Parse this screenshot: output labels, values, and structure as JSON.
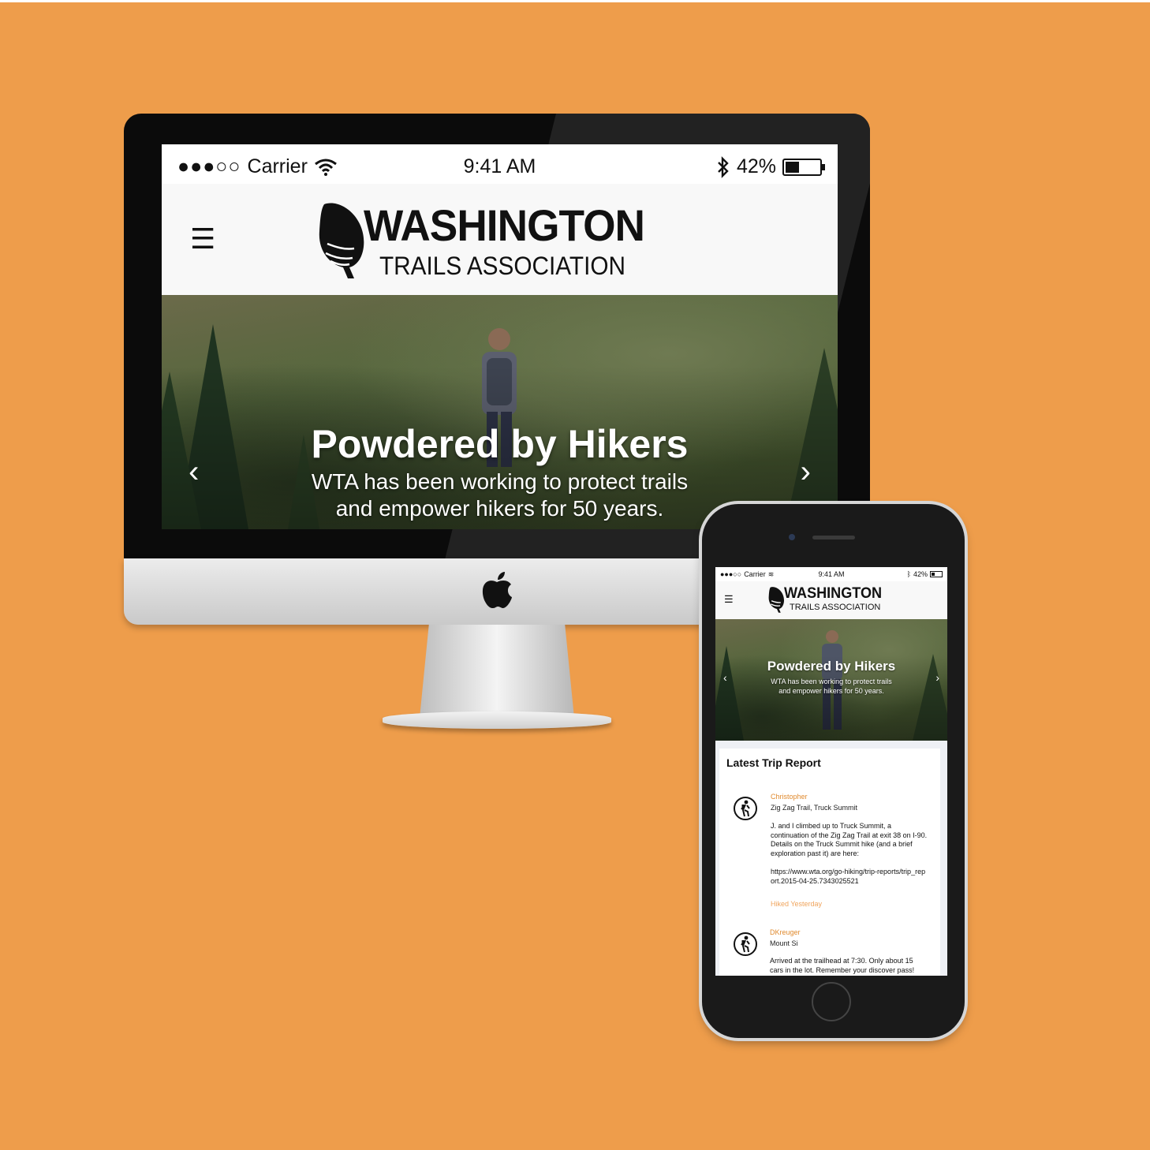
{
  "status_bar": {
    "signal": "●●●○○",
    "carrier": "Carrier",
    "time": "9:41 AM",
    "battery": "42%",
    "battery_level": 0.42
  },
  "logo": {
    "line1": "WASHINGTON",
    "line2": "TRAILS ASSOCIATION"
  },
  "menu_icon": "☰",
  "hero": {
    "title": "Powdered by Hikers",
    "subtitle_line1": "WTA has been working to protect trails",
    "subtitle_line2": "and empower hikers for 50 years.",
    "prev_arrow": "‹",
    "next_arrow": "›"
  },
  "trip_reports": {
    "heading": "Latest Trip Report",
    "items": [
      {
        "author": "Christopher",
        "trail": "Zig Zag Trail, Truck Summit",
        "body": "J. and I climbed up to Truck Summit, a continuation of the Zig Zag Trail at exit 38 on I-90. Details on the Truck Summit hike (and a brief exploration past it) are here:",
        "link": "https://www.wta.org/go-hiking/trip-reports/trip_report.2015-04-25.7343025521",
        "hiked": "Hiked Yesterday"
      },
      {
        "author": "DKreuger",
        "trail": "Mount Si",
        "body": "Arrived at the trailhead at 7:30. Only about 15 cars in the lot. Remember your discover pass!"
      }
    ]
  },
  "colors": {
    "background": "#ee9d4b",
    "accent": "#e08a2e"
  }
}
